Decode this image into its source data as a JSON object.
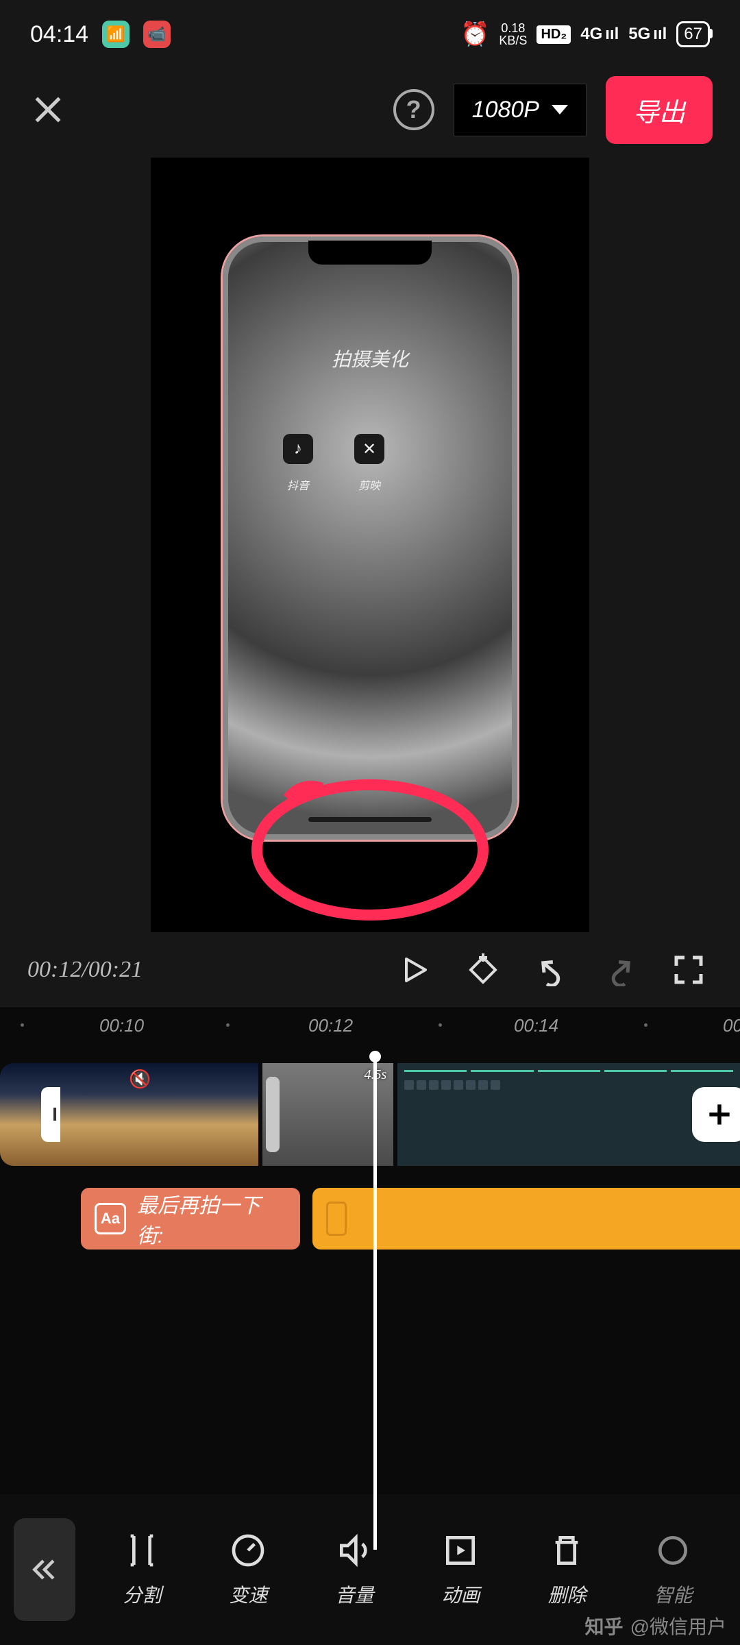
{
  "status_bar": {
    "time": "04:14",
    "net_speed_value": "0.18",
    "net_speed_unit": "KB/S",
    "hd_badge": "HD₂",
    "signal_4g": "4G",
    "signal_5g": "5G",
    "battery": "67"
  },
  "header": {
    "resolution": "1080P",
    "export_label": "导出"
  },
  "preview": {
    "phone_title": "拍摄美化",
    "apps": [
      {
        "icon": "♪",
        "label": "抖音"
      },
      {
        "icon": "✕",
        "label": "剪映"
      }
    ]
  },
  "playback": {
    "timecode": "00:12/00:21"
  },
  "ruler": {
    "marks": [
      "00:10",
      "00:12",
      "00:14",
      "00"
    ]
  },
  "clips": {
    "clip3_duration": "4.5s"
  },
  "text_track": {
    "clip1_text": "最后再拍一下街:"
  },
  "toolbar": {
    "items": [
      {
        "id": "split",
        "label": "分割"
      },
      {
        "id": "speed",
        "label": "变速"
      },
      {
        "id": "volume",
        "label": "音量"
      },
      {
        "id": "animation",
        "label": "动画"
      },
      {
        "id": "delete",
        "label": "删除"
      },
      {
        "id": "smart",
        "label": "智能"
      }
    ]
  },
  "watermark": {
    "brand": "知乎",
    "user": "@微信用户"
  }
}
